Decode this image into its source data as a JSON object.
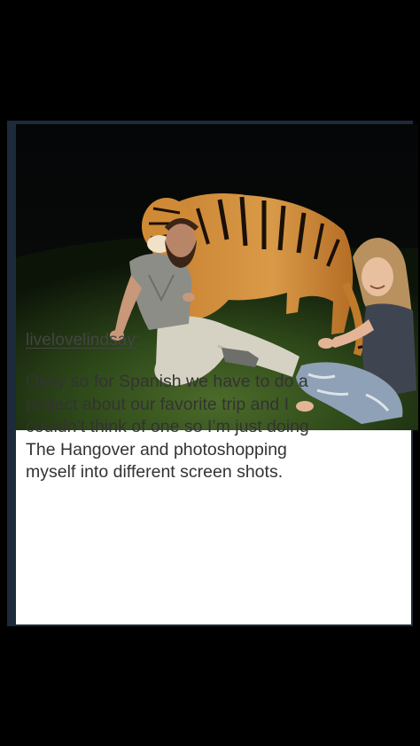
{
  "post": {
    "photo": {
      "description_icon": "photo-image"
    },
    "username": "livelovelindsay",
    "username_suffix": ":",
    "body_lines": [
      "Okay so for Spanish we have to do a",
      "project about our favorite trip and I",
      "couldn’t think of one so I’m just doing",
      "The Hangover and photoshopping",
      "myself into different screen shots."
    ]
  },
  "colors": {
    "background": "#000000",
    "card": "#ffffff",
    "text": "#333333",
    "username": "#444444"
  }
}
